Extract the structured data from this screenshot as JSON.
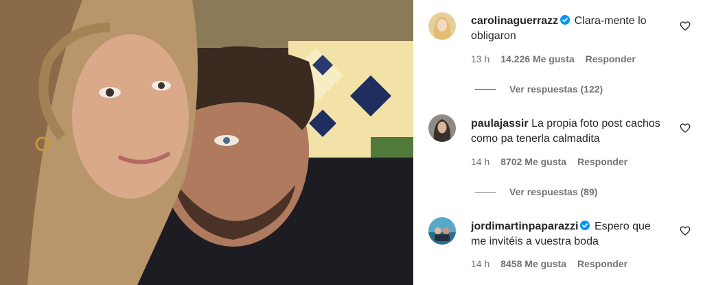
{
  "photo": {
    "alt": ""
  },
  "comments": [
    {
      "username": "carolinaguerrazz",
      "verified": true,
      "text": "Clara-mente lo obligaron",
      "time": "13 h",
      "likes": "14.226 Me gusta",
      "reply": "Responder",
      "view_replies": "Ver respuestas (122)"
    },
    {
      "username": "paulajassir",
      "verified": false,
      "text": "La propia foto post cachos como pa tenerla calmadita",
      "time": "14 h",
      "likes": "8702 Me gusta",
      "reply": "Responder",
      "view_replies": "Ver respuestas (89)"
    },
    {
      "username": "jordimartinpaparazzi",
      "verified": true,
      "text": "Espero que me invitéis a vuestra boda",
      "time": "14 h",
      "likes": "8458 Me gusta",
      "reply": "Responder"
    }
  ],
  "icons": {
    "like": "heart-outline-icon",
    "verified": "verified-badge-icon"
  },
  "colors": {
    "text": "#262626",
    "secondary": "#737373",
    "verified": "#0095f6"
  }
}
